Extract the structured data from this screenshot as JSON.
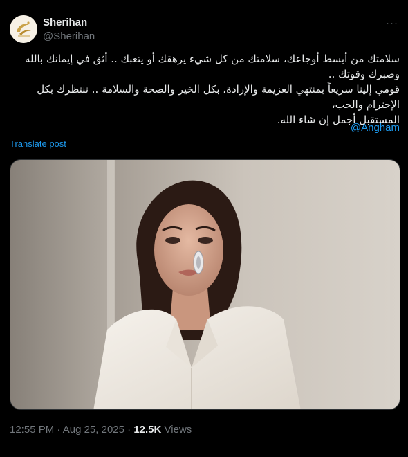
{
  "author": {
    "display_name": "Sherihan",
    "handle": "@Sherihan"
  },
  "more_label": "···",
  "tweet": {
    "lines": [
      "سلامتك من أبسط أوجاعك، سلامتك من كل شيء يرهقك أو يتعبك .. أثق في إيمانك بالله وصبرك وقوتك ..",
      "قومي إلينا سريعاً بمنتهي العزيمة والإرادة، بكل الخير والصحة والسلامة .. ننتظرك بكل الإحترام والحب،",
      "المستقبل أجمل إن شاء الله."
    ],
    "mention": "@Angham"
  },
  "translate_label": "Translate post",
  "meta": {
    "time": "12:55 PM",
    "date": "Aug 25, 2025",
    "separator": "·",
    "views_count": "12.5K",
    "views_label": "Views"
  },
  "colors": {
    "background": "#000000",
    "text": "#e7e9ea",
    "secondary": "#71767b",
    "link": "#1d9bf0"
  }
}
